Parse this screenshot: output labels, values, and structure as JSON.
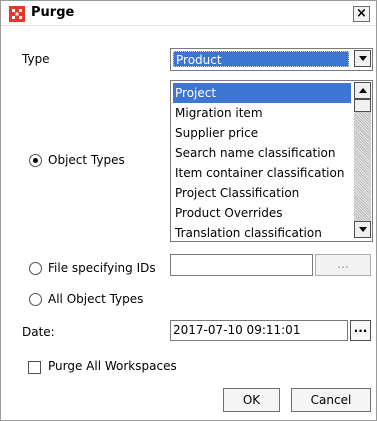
{
  "window": {
    "title": "Purge"
  },
  "type_field": {
    "label": "Type",
    "selected": "Product"
  },
  "object_types": {
    "label": "Object Types",
    "items": [
      "Project",
      "Migration item",
      "Supplier price",
      "Search name classification",
      "Item container classification",
      "Project Classification",
      "Product Overrides",
      "Translation classification"
    ],
    "selected_index": 0
  },
  "file_ids": {
    "label": "File specifying IDs",
    "value": "",
    "browse_label": "..."
  },
  "all_object_types": {
    "label": "All Object Types"
  },
  "date_field": {
    "label": "Date:",
    "value": "2017-07-10 09:11:01",
    "picker_label": "..."
  },
  "purge_all_workspaces": {
    "label": "Purge All Workspaces",
    "checked": false
  },
  "buttons": {
    "ok": "OK",
    "cancel": "Cancel"
  },
  "close_label": "×",
  "colors": {
    "selection": "#3f75d2",
    "app_icon": "#e8372a"
  }
}
